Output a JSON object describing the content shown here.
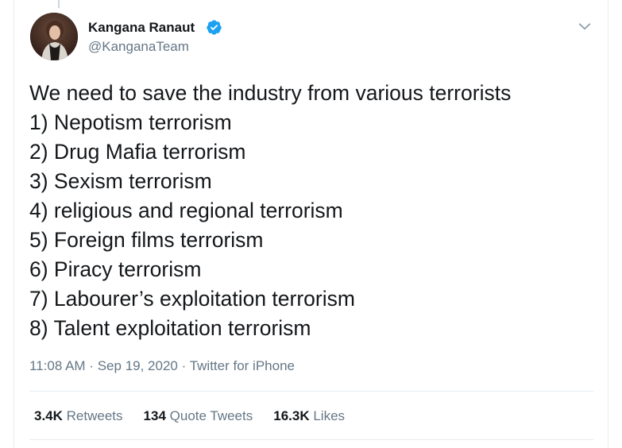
{
  "author": {
    "display_name": "Kangana Ranaut",
    "handle": "@KanganaTeam",
    "verified": true,
    "avatar_icon": "profile-photo"
  },
  "tweet": {
    "lines": [
      "We need to save the industry from various terrorists",
      "1) Nepotism terrorism",
      "2) Drug Mafia terrorism",
      "3) Sexism terrorism",
      "4) religious and regional terrorism",
      "5) Foreign films terrorism",
      "6) Piracy terrorism",
      "7) Labourer’s exploitation terrorism",
      "8) Talent exploitation terrorism"
    ]
  },
  "meta": {
    "time": "11:08 AM",
    "separator": "·",
    "date": "Sep 19, 2020",
    "source": "Twitter for iPhone"
  },
  "stats": {
    "retweets_count": "3.4K",
    "retweets_label": "Retweets",
    "quotes_count": "134",
    "quotes_label": "Quote Tweets",
    "likes_count": "16.3K",
    "likes_label": "Likes"
  },
  "colors": {
    "text": "#14171a",
    "secondary": "#657786",
    "verified": "#1da1f2",
    "divider": "#e6ecf0"
  }
}
